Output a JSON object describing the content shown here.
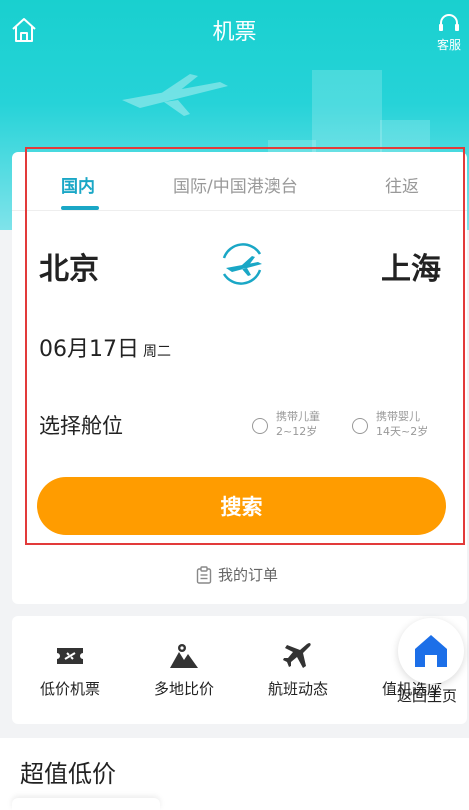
{
  "header": {
    "title": "机票",
    "service_label": "客服"
  },
  "tabs": [
    {
      "label": "国内",
      "active": true
    },
    {
      "label": "国际/中国港澳台",
      "active": false
    },
    {
      "label": "往返",
      "active": false
    }
  ],
  "route": {
    "from": "北京",
    "to": "上海"
  },
  "date": {
    "value": "06月17日",
    "weekday": "周二"
  },
  "cabin": {
    "label": "选择舱位"
  },
  "options": {
    "child": {
      "line1": "携带儿童",
      "line2": "2~12岁",
      "checked": false
    },
    "infant": {
      "line1": "携带婴儿",
      "line2": "14天~2岁",
      "checked": false
    }
  },
  "search_label": "搜索",
  "orders_label": "我的订单",
  "quick_links": [
    {
      "label": "低价机票",
      "icon": "ticket-icon"
    },
    {
      "label": "多地比价",
      "icon": "map-pin-icon"
    },
    {
      "label": "航班动态",
      "icon": "airplane-icon"
    },
    {
      "label": "值机选座",
      "icon": "seat-icon"
    }
  ],
  "floating": {
    "label": "返回主页",
    "icon": "home-icon"
  },
  "section": {
    "title": "超值低价"
  },
  "colors": {
    "accent": "#1aa7c6",
    "button": "#ff9c00",
    "hero": "#19d0cf",
    "highlight": "#e23a3a"
  }
}
